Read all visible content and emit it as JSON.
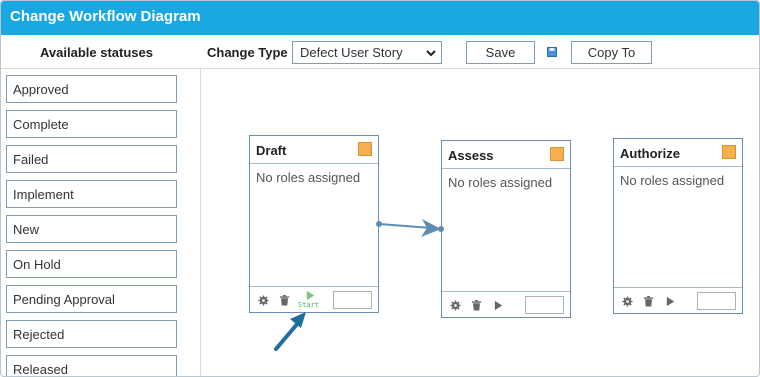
{
  "window": {
    "title": "Change Workflow Diagram"
  },
  "toolbar": {
    "available_heading": "Available statuses",
    "change_type_label": "Change Type",
    "change_type_value": "Defect User Story",
    "save_label": "Save",
    "copy_label": "Copy To"
  },
  "sidebar": {
    "items": [
      {
        "label": "Approved"
      },
      {
        "label": "Complete"
      },
      {
        "label": "Failed"
      },
      {
        "label": "Implement"
      },
      {
        "label": "New"
      },
      {
        "label": "On Hold"
      },
      {
        "label": "Pending Approval"
      },
      {
        "label": "Rejected"
      },
      {
        "label": "Released"
      }
    ]
  },
  "nodes": [
    {
      "title": "Draft",
      "roles": "No roles assigned",
      "start_label": "Start",
      "color": "#f5b04d"
    },
    {
      "title": "Assess",
      "roles": "No roles assigned",
      "color": "#f5b04d"
    },
    {
      "title": "Authorize",
      "roles": "No roles assigned",
      "color": "#f5b04d"
    }
  ],
  "colors": {
    "header": "#1aa8e2",
    "connector": "#5b8db5",
    "callout_arrow": "#1f6e9e",
    "start_green": "#4caf50"
  },
  "icons": [
    "chevron-down-icon",
    "save-icon",
    "gear-icon",
    "trash-icon",
    "play-icon"
  ]
}
